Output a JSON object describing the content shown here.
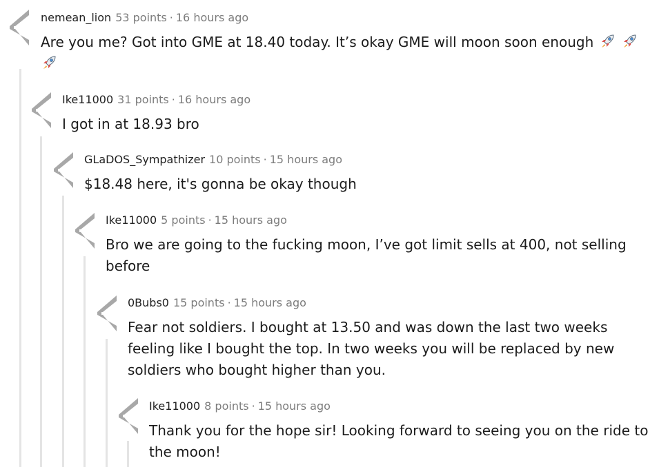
{
  "comments": [
    {
      "author": "nemean_lion",
      "points": "53 points",
      "separator": "·",
      "time": "16 hours ago",
      "body": "Are you me? Got into GME at 18.40 today. It’s okay GME will moon soon enough",
      "emojis": [
        "rocket-emoji",
        "rocket-emoji",
        "rocket-emoji"
      ]
    },
    {
      "author": "Ike11000",
      "points": "31 points",
      "separator": "·",
      "time": "16 hours ago",
      "body": "I got in at 18.93 bro"
    },
    {
      "author": "GLaDOS_Sympathizer",
      "points": "10 points",
      "separator": "·",
      "time": "15 hours ago",
      "body": "$18.48 here, it's gonna be okay though"
    },
    {
      "author": "Ike11000",
      "points": "5 points",
      "separator": "·",
      "time": "15 hours ago",
      "body": "Bro we are going to the fucking moon, I’ve got limit sells at 400, not selling before"
    },
    {
      "author": "0Bubs0",
      "points": "15 points",
      "separator": "·",
      "time": "15 hours ago",
      "body": "Fear not soldiers. I bought at 13.50 and was down the last two weeks feeling like I bought the top. In two weeks you will be replaced by new soldiers who bought higher than you."
    },
    {
      "author": "Ike11000",
      "points": "8 points",
      "separator": "·",
      "time": "15 hours ago",
      "body": "Thank you for the hope sir! Looking forward to seeing you on the ride to the moon!"
    }
  ],
  "icons": {
    "vote": "upvote-downvote-arrows-icon",
    "emoji": "rocket-emoji"
  },
  "colors": {
    "text": "#1c1c1c",
    "meta": "#7c7c7c",
    "thread_line": "#e4e4e4",
    "vote_arrow": "#a8a8a8"
  }
}
